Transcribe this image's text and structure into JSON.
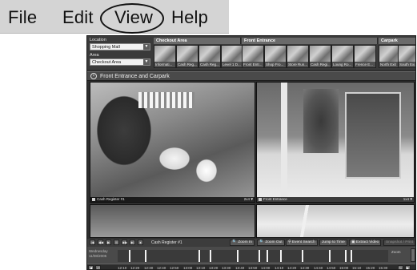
{
  "menu": {
    "items": [
      {
        "id": "file",
        "label": "File"
      },
      {
        "id": "edit",
        "label": "Edit"
      },
      {
        "id": "view",
        "label": "View"
      },
      {
        "id": "help",
        "label": "Help"
      }
    ]
  },
  "header": {
    "location": {
      "label": "Location",
      "value": "Shopping Mall"
    },
    "area": {
      "label": "Area",
      "value": "Checkout Area"
    },
    "groups": [
      {
        "name": "Checkout Area",
        "cameras": [
          "Informati...",
          "Cash Reg...",
          "Cash Reg...",
          "Level 1 D..."
        ]
      },
      {
        "name": "Front Entrance",
        "cameras": [
          "Front Entr...",
          "Shop Fro...",
          "Store Run...",
          "Cash Regi...",
          "Loung Ro...",
          "Frence E..."
        ]
      },
      {
        "name": "Carpark",
        "cameras": [
          "North Exit",
          "South Exi..."
        ]
      }
    ]
  },
  "view": {
    "title": "Front Entrance and Carpark"
  },
  "cameras": {
    "cam1": {
      "label": "Cash Register #1",
      "res": "2x4"
    },
    "cam2": {
      "label": "Front Entrance",
      "res": "1x4"
    }
  },
  "toolbar": {
    "active_camera": "Cash Register #1",
    "actions": [
      {
        "id": "zoom-in",
        "label": "Zoom In",
        "enabled": true
      },
      {
        "id": "zoom-out",
        "label": "Zoom Out",
        "enabled": true
      },
      {
        "id": "event-search",
        "label": "Event Search",
        "enabled": true
      },
      {
        "id": "jump-to-time",
        "label": "Jump to Time",
        "enabled": true
      },
      {
        "id": "extract-video",
        "label": "Extract Video",
        "enabled": true
      },
      {
        "id": "more",
        "label": "Snapshot / Print",
        "enabled": false
      }
    ]
  },
  "timeline": {
    "date_lines": [
      "Wednesday",
      "11/08/2005"
    ],
    "zoom_label": "Zoom",
    "ticks": [
      "12:10",
      "12:20",
      "12:30",
      "12:40",
      "12:50",
      "13:00",
      "13:10",
      "13:20",
      "13:30",
      "13:40",
      "13:50",
      "14:00",
      "14:10",
      "14:20",
      "14:30",
      "14:40",
      "14:50",
      "15:00",
      "15:10",
      "15:20",
      "15:30"
    ],
    "event_marks": [
      0.04,
      0.1,
      0.3,
      0.34,
      0.44,
      0.52,
      0.55,
      0.6,
      0.68,
      0.78,
      0.84,
      0.86
    ]
  }
}
